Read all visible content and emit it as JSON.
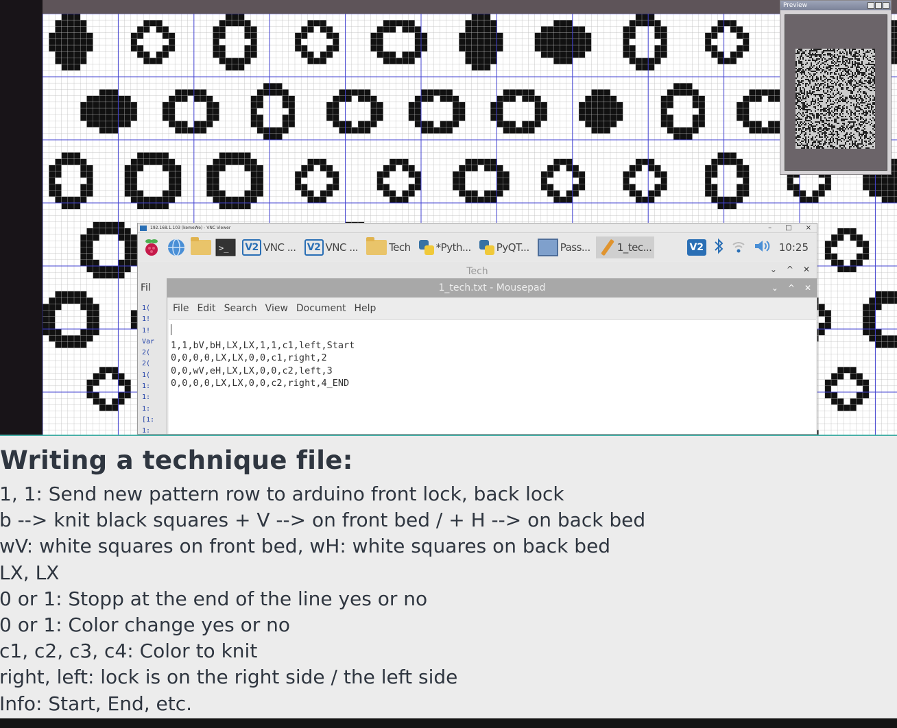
{
  "vnc_window": {
    "title": "192.168.1.103 (kemeWe) - VNC Viewer",
    "controls": [
      "–",
      "□",
      "×"
    ]
  },
  "taskbar": {
    "apps": [
      {
        "label": "VNC ...",
        "icon": "vnc-icon"
      },
      {
        "label": "VNC ...",
        "icon": "vnc-icon"
      },
      {
        "label": "Tech",
        "icon": "folder-icon"
      },
      {
        "label": "*Pyth...",
        "icon": "python-icon"
      },
      {
        "label": "PyQT...",
        "icon": "python-icon"
      },
      {
        "label": "Pass...",
        "icon": "window-icon"
      },
      {
        "label": "1_tec...",
        "icon": "pencil-icon"
      }
    ],
    "clock": "10:25"
  },
  "tech_window": {
    "title": "Tech",
    "menu_partial": "Fil",
    "line_numbers": [
      "1(",
      "1!",
      "1!",
      "Var",
      "2(",
      "2(",
      "1(",
      "1:",
      "1:",
      "1:",
      "[1:",
      "1:"
    ]
  },
  "mousepad": {
    "title": "1_tech.txt - Mousepad",
    "menu": [
      "File",
      "Edit",
      "Search",
      "View",
      "Document",
      "Help"
    ],
    "lines": [
      "1,1,bV,bH,LX,LX,1,1,c1,left,Start",
      "0,0,0,0,LX,LX,0,0,c1,right,2",
      "0,0,wV,eH,LX,LX,0,0,c2,left,3",
      "0,0,0,0,LX,LX,0,0,c2,right,4_END"
    ]
  },
  "preview": {
    "title": "Preview"
  },
  "slide": {
    "heading": "Writing a technique file:",
    "items": [
      "1, 1: Send new pattern row to arduino front lock, back lock",
      "b --> knit black squares + V --> on front bed / + H --> on back bed",
      "wV: white squares on front bed, wH: white squares on back bed",
      "LX, LX",
      "0 or 1: Stopp at the end of the line yes or no",
      "0 or 1: Color change yes or no",
      "c1, c2, c3, c4: Color to knit",
      "right, left: lock is on the right side / the left side",
      "Info: Start, End, etc."
    ]
  }
}
